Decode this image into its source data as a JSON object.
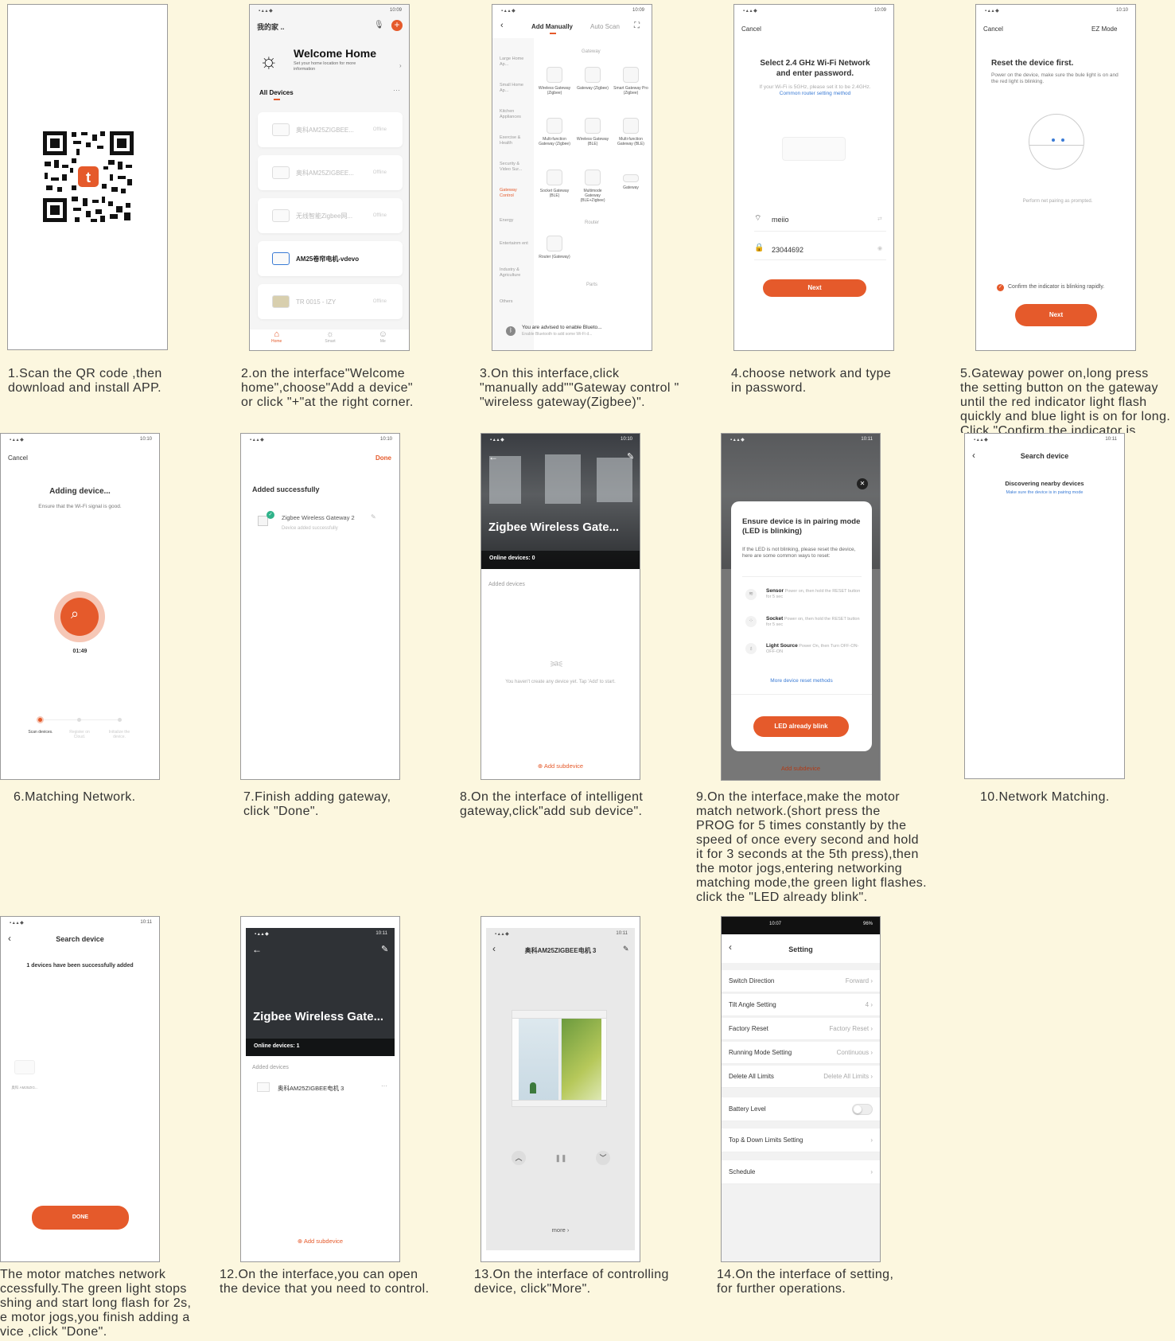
{
  "colors": {
    "bg": "#fcf7df",
    "accent": "#e55a2b",
    "link": "#3a7bd5",
    "green": "#2fb38a"
  },
  "captions": [
    "1.Scan the QR code ,then\ndownload and install APP.",
    "2.on the interface\"Welcome\nhome\",choose\"Add a device\"\nor click \"+\"at the right corner.",
    "3.On this interface,click\n\"manually add\"\"Gateway control \"\n\"wireless gateway(Zigbee)\".",
    "4.choose network and type\nin password.",
    "5.Gateway power on,long press\nthe setting button on the gateway\nuntil the red indicator light flash\nquickly and blue light is on for long.\nClick \"Confirm the indicator is",
    "6.Matching Network.",
    "7.Finish adding gateway,\nclick \"Done\".",
    "8.On the interface of intelligent\ngateway,click\"add sub device\".",
    "9.On the interface,make the motor\nmatch network.(short press the\nPROG for 5 times constantly by the\nspeed of once every second and hold\nit for 3 seconds at the 5th press),then\nthe motor jogs,entering networking\nmatching mode,the green light flashes.\nclick the \"LED already blink\".",
    "10.Network Matching.",
    "The motor matches network\nccessfully.The green light stops\nshing and start long flash for 2s,\ne motor jogs,you finish adding a\nvice ,click \"Done\".",
    "12.On the interface,you can open\nthe device that you need to control.",
    "13.On the interface of controlling\ndevice,  click\"More\".",
    "14.On the interface of setting,\nfor further operations."
  ],
  "s2": {
    "time": "10:09",
    "home": "我的家 ..",
    "title": "Welcome Home",
    "subtitle": "Set your home location for more information",
    "all_devices": "All Devices",
    "devices": [
      {
        "name": "奥科AM25ZIGBEE...",
        "status": "Offline"
      },
      {
        "name": "奥科AM25ZIGBEE...",
        "status": "Offline"
      },
      {
        "name": "无线智能Zigbee网...",
        "status": "Offline"
      },
      {
        "name": "AM25卷帘电机-vdevo",
        "status": ""
      },
      {
        "name": "TR 0015 - IZY",
        "status": "Offline"
      }
    ],
    "tabs": [
      "Home",
      "Smart",
      "Me"
    ]
  },
  "s3": {
    "time": "10:09",
    "tab_manual": "Add Manually",
    "tab_auto": "Auto Scan",
    "gateway_header": "Gateway",
    "router_header": "Router",
    "parts_header": "Parts",
    "categories": [
      "Large Home Ap...",
      "Small Home Ap...",
      "Kitchen Appliances",
      "Exercise & Health",
      "Security & Video Sur...",
      "Gateway Control",
      "Energy",
      "Entertainm ent",
      "Industry & Agriculture",
      "Others"
    ],
    "gateways": [
      "Wireless Gateway (Zigbee)",
      "Gateway (Zigbee)",
      "Smart Gateway Pro (Zigbee)",
      "Multi-function Gateway (Zigbee)",
      "Wireless Gateway (BLE)",
      "Multi-function Gateway (BLE)",
      "Socket Gateway (BLE)",
      "Multimode Gateway (BLE+Zigbee)",
      "Gateway"
    ],
    "router": "Router (Gateway)",
    "bt_title": "You are advised to enable Blueto...",
    "bt_sub": "Enable Bluetooth to add some Wi-Fi d..."
  },
  "s4": {
    "time": "10:09",
    "cancel": "Cancel",
    "title": "Select 2.4 GHz Wi-Fi Network and enter password.",
    "hint": "If your Wi-Fi is 5GHz, please set it to be 2.4GHz.",
    "hint_link": "Common router setting method",
    "ssid": "meiio",
    "password": "23044692",
    "next": "Next"
  },
  "s5": {
    "time": "10:10",
    "cancel": "Cancel",
    "mode": "EZ Mode",
    "title": "Reset the device first.",
    "desc": "Power on the device, make sure the bule light is on and the red light is blinking.",
    "perform": "Perform net pairing as prompted.",
    "confirm": "Confirm the indicator is blinking rapidly.",
    "next": "Next"
  },
  "s6": {
    "time": "10:10",
    "cancel": "Cancel",
    "title": "Adding device...",
    "sub": "Ensure that the Wi-Fi signal is good.",
    "timer": "01:49",
    "steps": [
      "Scan devices.",
      "Register on Cloud.",
      "Initialize the device."
    ]
  },
  "s7": {
    "time": "10:10",
    "done": "Done",
    "title": "Added successfully",
    "device": "Zigbee Wireless Gateway 2",
    "device_sub": "Device added successfully"
  },
  "s8": {
    "time": "10:10",
    "title": "Zigbee Wireless Gate...",
    "online": "Online devices: 0",
    "added": "Added devices",
    "empty": "You haven't create any device yet. Tap 'Add' to start.",
    "add_sub": "Add subdevice"
  },
  "s9": {
    "time": "10:11",
    "title": "Ensure device is in pairing mode (LED is blinking)",
    "desc": "If the LED is not blinking, please reset the device, here are some common ways to reset:",
    "methods": [
      {
        "name": "Sensor",
        "desc": "Power on, then hold the RESET button for 5 sec"
      },
      {
        "name": "Socket",
        "desc": "Power on, then hold the RESET button for 5 sec"
      },
      {
        "name": "Light Source",
        "desc": "Power On, then Turn OFF-ON-OFF-ON"
      }
    ],
    "more": "More device reset methods",
    "btn": "LED already blink",
    "add_sub": "Add subdevice"
  },
  "s10": {
    "time": "10:11",
    "title": "Search device",
    "discover": "Discovering nearby devices",
    "pairing": "Make sure the device is in pairing mode"
  },
  "s11": {
    "time": "10:11",
    "title": "Search device",
    "added": "1 devices have been successfully added",
    "dev_label": "奥科 AM25ZIG...",
    "done": "DONE"
  },
  "s12": {
    "time": "10:11",
    "title": "Zigbee Wireless Gate...",
    "online": "Online devices: 1",
    "added": "Added devices",
    "device": "奥科AM25ZIGBEE电机 3",
    "add_sub": "Add subdevice"
  },
  "s13": {
    "time": "10:11",
    "title": "奥科AM25ZIGBEE电机 3",
    "more": "more"
  },
  "s14": {
    "time": "10:07",
    "battery": "96%",
    "title": "Setting",
    "rows": [
      {
        "label": "Switch Direction",
        "value": "Forward"
      },
      {
        "label": "Tilt Angle Setting",
        "value": "4"
      },
      {
        "label": "Factory Reset",
        "value": "Factory Reset"
      },
      {
        "label": "Running Mode Setting",
        "value": "Continuous"
      },
      {
        "label": "Delete All Limits",
        "value": "Delete All Limits"
      }
    ],
    "battery_level": "Battery Level",
    "top_down": "Top & Down Limits Setting",
    "schedule": "Schedule"
  }
}
